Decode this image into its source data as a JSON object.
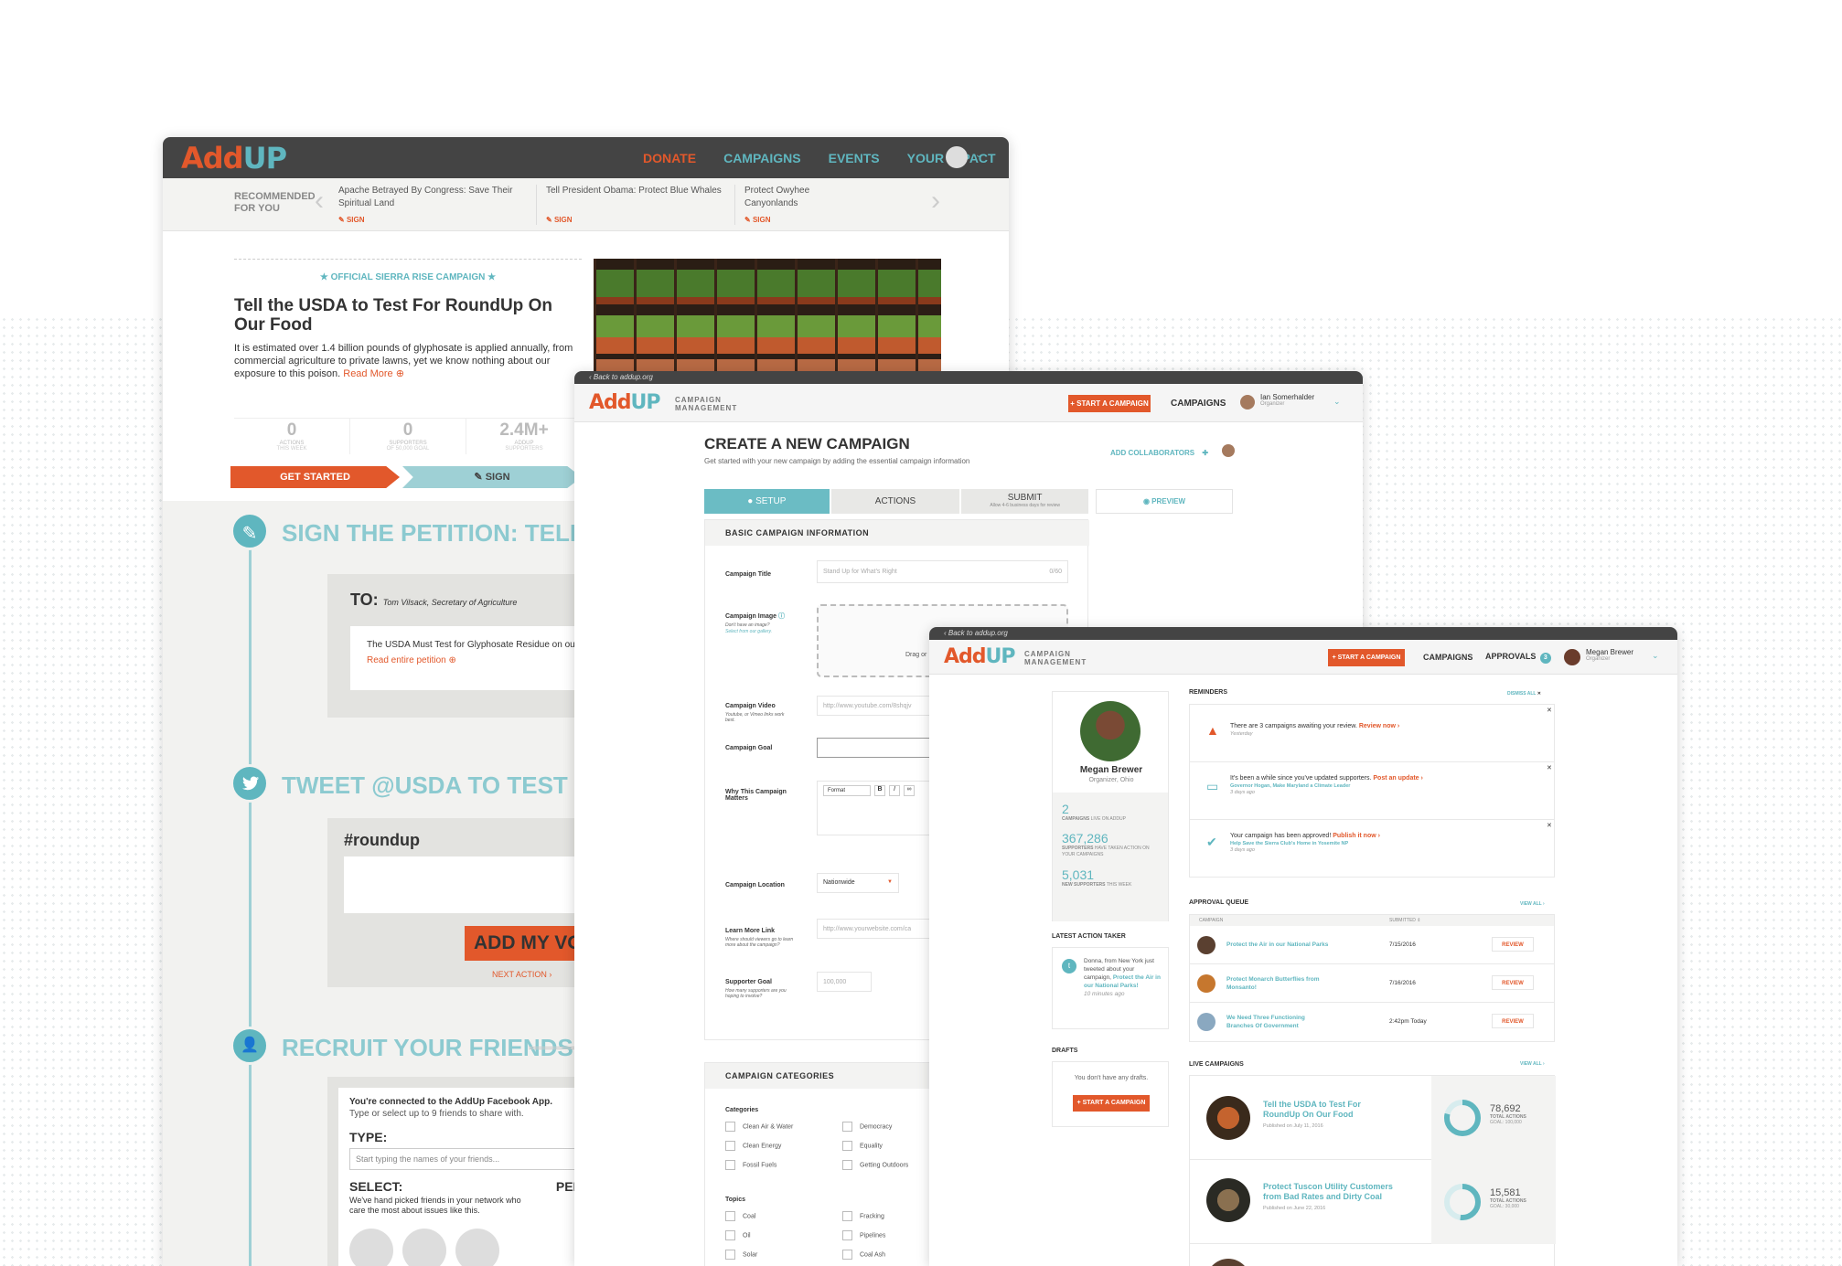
{
  "brand": {
    "logo": "AddUP"
  },
  "win1": {
    "nav": [
      "DONATE",
      "CAMPAIGNS",
      "EVENTS",
      "YOUR IMPACT"
    ],
    "rec_label": "RECOMMENDED FOR YOU",
    "rec": [
      {
        "title": "Apache Betrayed By Congress: Save Their Spiritual Land",
        "action": "SIGN"
      },
      {
        "title": "Tell President Obama: Protect Blue Whales",
        "action": "SIGN"
      },
      {
        "title": "Protect Owyhee Canyonlands",
        "action": "SIGN"
      }
    ],
    "official": "OFFICIAL SIERRA RISE CAMPAIGN",
    "title": "Tell the USDA to Test For RoundUp On Our Food",
    "desc": "It is estimated over 1.4 billion pounds of glyphosate is applied annually, from commercial agriculture to private lawns, yet we know nothing about our exposure to this poison.",
    "read_more": "Read More",
    "stats": [
      {
        "value": "0",
        "label": "ACTIONS",
        "sub": "THIS WEEK"
      },
      {
        "value": "0",
        "label": "SUPPORTERS",
        "sub": "OF 50,000 GOAL"
      },
      {
        "value": "2.4M+",
        "label": "ADDUP",
        "sub": "SUPPORTERS"
      }
    ],
    "get_started": "GET STARTED",
    "sign": "SIGN",
    "step1": "SIGN THE PETITION: TELL THE USDA",
    "to_label": "TO:",
    "to_value": "Tom Vilsack, Secretary of Agriculture",
    "petition_text": "The USDA Must Test for Glyphosate Residue on our Fo",
    "read_entire": "Read entire petition",
    "step2": "TWEET @USDA TO TEST FOR GLYPHO",
    "hashtag": "#roundup",
    "add_voice": "ADD MY VOI",
    "next_action": "NEXT ACTION",
    "step3": "RECRUIT YOUR FRIENDS",
    "fb_connected": "You're connected to the AddUp Facebook App.",
    "fb_sub": "Type or select up to 9 friends to share with.",
    "type_label": "TYPE:",
    "type_placeholder": "Start typing the names of your friends...",
    "select_label": "SELECT:",
    "pers_label": "PERS",
    "select_desc": "We've hand picked friends in your network who care the most about issues like this."
  },
  "win2": {
    "back": "Back to addup.org",
    "cm": "CAMPAIGN MANAGEMENT",
    "start": "START A CAMPAIGN",
    "campaigns": "CAMPAIGNS",
    "user_name": "Ian Somerhalder",
    "user_role": "Organizer",
    "title": "CREATE A NEW CAMPAIGN",
    "subtitle": "Get started with your new campaign by adding the essential campaign information",
    "collab": "ADD COLLABORATORS",
    "tabs": [
      "SETUP",
      "ACTIONS",
      "SUBMIT"
    ],
    "submit_sub": "Allow 4-6 business days for review",
    "preview": "PREVIEW",
    "section1": "BASIC CAMPAIGN INFORMATION",
    "f_title": "Campaign Title",
    "f_title_ph": "Stand Up for What's Right",
    "f_title_count": "0/60",
    "f_image": "Campaign Image",
    "f_image_sub": "Don't have an image?",
    "f_image_link": "Select from our gallery.",
    "drag": "Drag or",
    "f_video": "Campaign Video",
    "f_video_sub": "Youtube, or Vimeo links work best.",
    "f_video_ph": "http://www.youtube.com/8shqjv",
    "f_goal": "Campaign Goal",
    "f_why": "Why This Campaign Matters",
    "format": "Format",
    "f_location": "Campaign Location",
    "f_location_val": "Nationwide",
    "f_learn": "Learn More Link",
    "f_learn_sub": "Where should viewers go to learn more about the campaign?",
    "f_learn_ph": "http://www.yourwebsite.com/ca",
    "f_sgoal": "Supporter Goal",
    "f_sgoal_sub": "How many supporters are you hoping to involve?",
    "f_sgoal_ph": "100,000",
    "section2": "CAMPAIGN CATEGORIES",
    "cat_label": "Categories",
    "cats": [
      "Clean Air & Water",
      "Democracy",
      "Clean Energy",
      "Equality",
      "Fossil Fuels",
      "Getting Outdoors"
    ],
    "topic_label": "Topics",
    "topics": [
      "Coal",
      "Fracking",
      "Oil",
      "Pipelines",
      "Solar",
      "Coal Ash"
    ]
  },
  "win3": {
    "back": "Back to addup.org",
    "cm": "CAMPAIGN MANAGEMENT",
    "start": "START A CAMPAIGN",
    "campaigns": "CAMPAIGNS",
    "approvals": "APPROVALS",
    "approvals_count": "3",
    "user_name": "Megan Brewer",
    "user_role": "Organizer",
    "profile_name": "Megan Brewer",
    "profile_role": "Organizer, Ohio",
    "s1_val": "2",
    "s1_label": "CAMPAIGNS",
    "s1_sub": "LIVE ON ADDUP",
    "s2_val": "367,286",
    "s2_label": "SUPPORTERS",
    "s2_sub": "HAVE TAKEN ACTION ON YOUR CAMPAIGNS",
    "s3_val": "5,031",
    "s3_label": "NEW SUPPORTERS",
    "s3_sub": "THIS WEEK",
    "latest": "LATEST ACTION TAKER",
    "latest_text": "Donna, from New York just tweeted about your campaign,",
    "latest_link": "Protect the Air in our National Parks!",
    "latest_time": "10 minutes ago",
    "drafts": "DRAFTS",
    "no_drafts": "You don't have any drafts.",
    "reminders": "REMINDERS",
    "dismiss": "DISMISS ALL",
    "rem": [
      {
        "text": "There are 3 campaigns awaiting your review.",
        "action": "Review now",
        "link": "",
        "time": "Yesterday"
      },
      {
        "text": "It's been a while since you've updated supporters.",
        "action": "Post an update",
        "link": "Governor Hogan, Make Maryland a Climate Leader",
        "time": "3 days ago"
      },
      {
        "text": "Your campaign has been approved!",
        "action": "Publish it now",
        "link": "Help Save the Sierra Club's Home in Yosemite NP",
        "time": "3 days ago"
      }
    ],
    "queue": "APPROVAL QUEUE",
    "view_all": "VIEW ALL",
    "col_campaign": "CAMPAIGN",
    "col_submitted": "SUBMITTED",
    "rows": [
      {
        "name": "Protect the Air in our National Parks",
        "date": "7/15/2016",
        "action": "REVIEW"
      },
      {
        "name": "Protect Monarch Butterflies from Monsanto!",
        "date": "7/16/2016",
        "action": "REVIEW"
      },
      {
        "name": "We Need Three Functioning Branches Of Government",
        "date": "2:42pm Today",
        "action": "REVIEW"
      }
    ],
    "live": "LIVE CAMPAIGNS",
    "live_items": [
      {
        "title": "Tell the USDA to Test For RoundUp On Our Food",
        "date": "Published on July 11, 2016",
        "actions": "78,692",
        "label": "TOTAL ACTIONS",
        "goal": "GOAL: 100,000",
        "progress": 0.79
      },
      {
        "title": "Protect Tuscon Utility Customers from Bad Rates and Dirty Coal",
        "date": "Published on June 22, 2016",
        "actions": "15,581",
        "label": "TOTAL ACTIONS",
        "goal": "GOAL: 30,000",
        "progress": 0.52
      }
    ]
  },
  "colors": {
    "orange": "#e2582b",
    "teal": "#5fb6bf",
    "dark": "#444444"
  }
}
